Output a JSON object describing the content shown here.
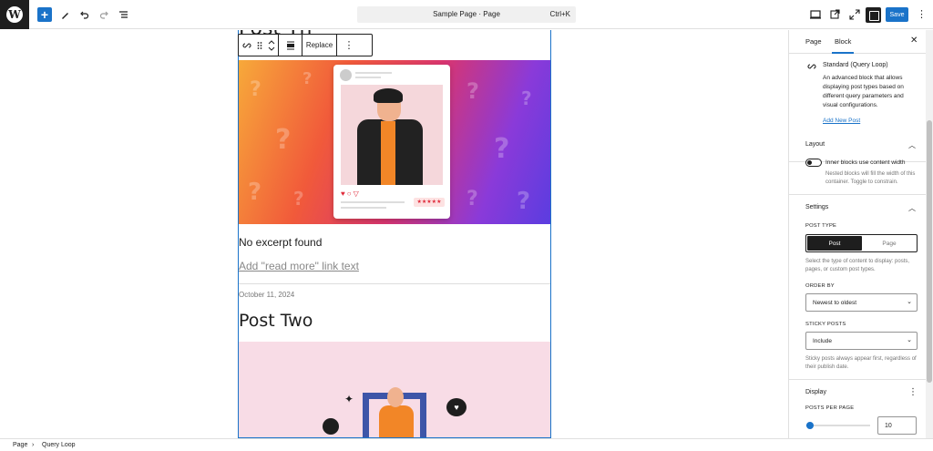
{
  "toolbar": {
    "inserter_symbol": "+",
    "document_title": "Sample Page · Page",
    "shortcut": "Ctrl+K",
    "save_label": "Save",
    "accent": "#1a73c9"
  },
  "block_toolbar": {
    "replace_label": "Replace"
  },
  "canvas": {
    "cut_title": "Post Th",
    "excerpt": "No excerpt found",
    "read_more": "Add \"read more\" link text",
    "date": "October 11, 2024",
    "post_title": "Post Two"
  },
  "sidebar": {
    "tabs": [
      "Page",
      "Block"
    ],
    "active_tab": "Block",
    "block": {
      "name": "Standard (Query Loop)",
      "description": "An advanced block that allows displaying post types based on different query parameters and visual configurations.",
      "link": "Add New Post"
    },
    "layout": {
      "title": "Layout",
      "toggle_label": "Inner blocks use content width",
      "help": "Nested blocks will fill the width of this container. Toggle to constrain."
    },
    "settings": {
      "title": "Settings",
      "post_type_label": "POST TYPE",
      "post_type_options": [
        "Post",
        "Page"
      ],
      "post_type_selected": "Post",
      "post_type_help": "Select the type of content to display: posts, pages, or custom post types.",
      "order_by_label": "ORDER BY",
      "order_by_value": "Newest to oldest",
      "sticky_label": "STICKY POSTS",
      "sticky_value": "Include",
      "sticky_help": "Sticky posts always appear first, regardless of their publish date."
    },
    "display": {
      "title": "Display",
      "posts_per_page_label": "POSTS PER PAGE",
      "posts_per_page": "10"
    }
  },
  "breadcrumb": [
    "Page",
    "Query Loop"
  ]
}
